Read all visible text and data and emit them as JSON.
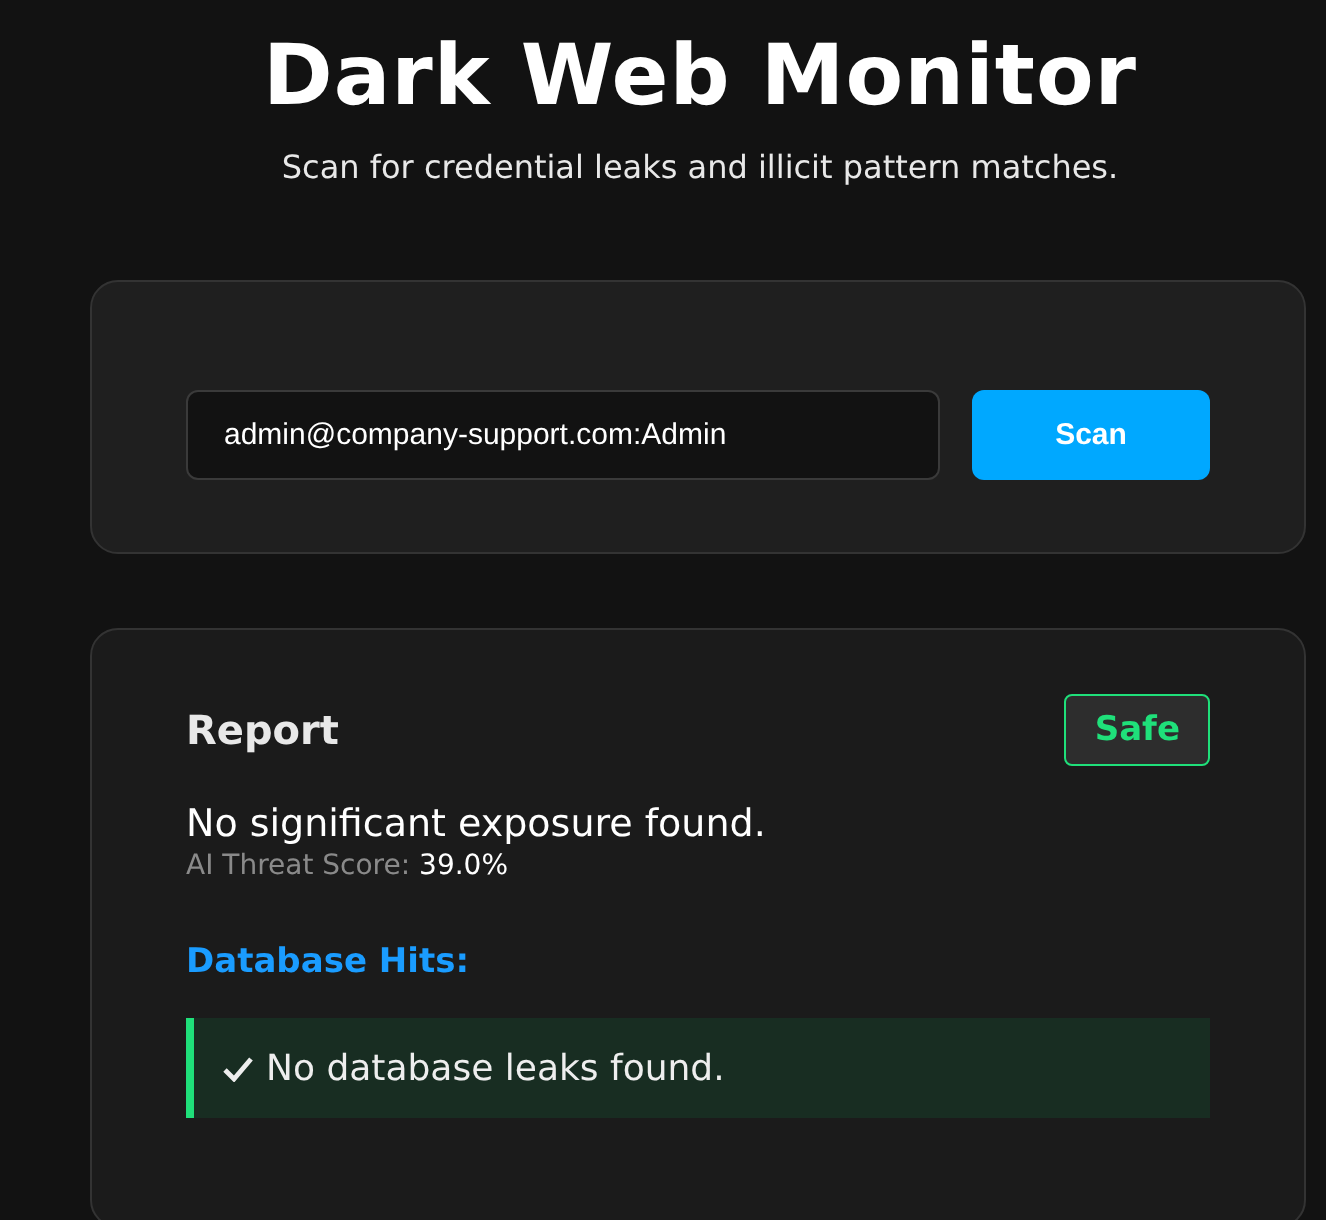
{
  "header": {
    "title": "Dark Web Monitor",
    "subtitle": "Scan for credential leaks and illicit pattern matches."
  },
  "scan": {
    "value": "admin@company-support.com:Admin",
    "button": "Scan"
  },
  "report": {
    "title": "Report",
    "status": {
      "label": "Safe",
      "kind": "safe"
    },
    "summary": "No significant exposure found.",
    "score_label": "AI Threat Score:",
    "score_value": "39.0%",
    "hits_title": "Database Hits:",
    "hits": [
      {
        "kind": "clear",
        "text": "No database leaks found."
      }
    ]
  }
}
